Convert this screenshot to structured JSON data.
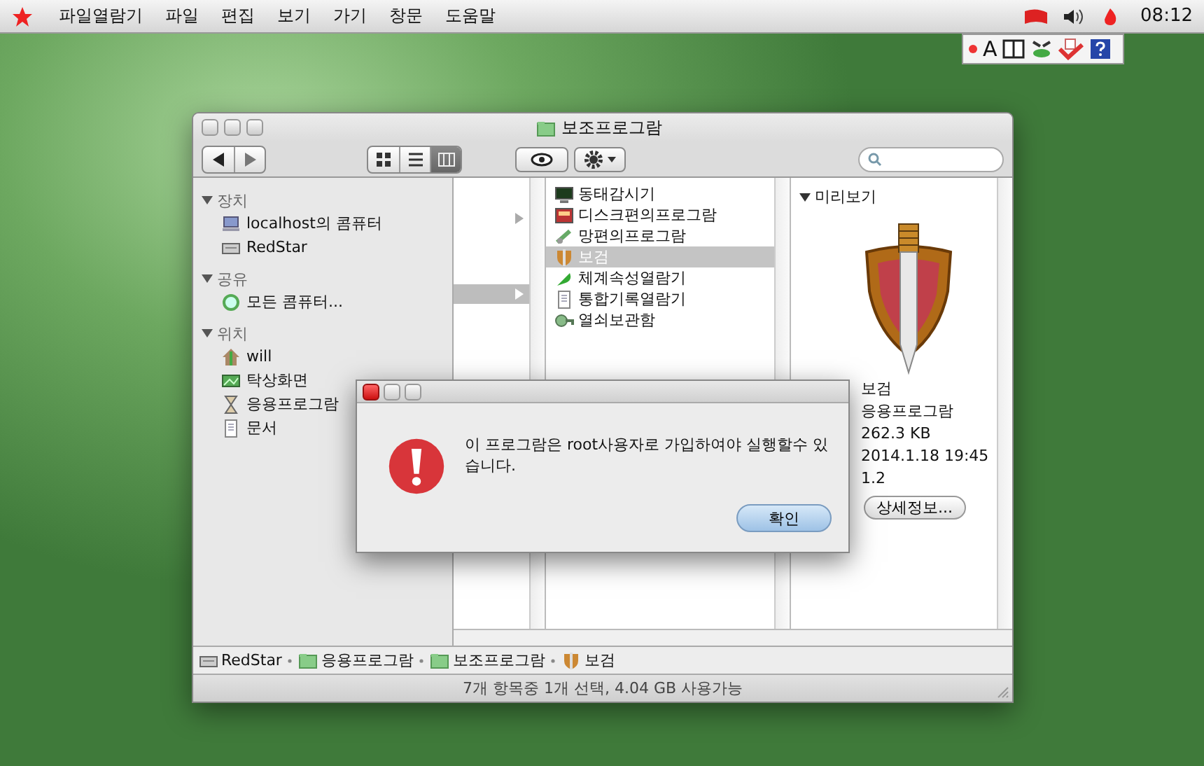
{
  "menubar": {
    "items": [
      {
        "label": "파일열람기",
        "selected": false
      },
      {
        "label": "파일",
        "selected": false
      },
      {
        "label": "편집",
        "selected": false
      },
      {
        "label": "보기",
        "selected": false
      },
      {
        "label": "가기",
        "selected": false
      },
      {
        "label": "창문",
        "selected": false
      },
      {
        "label": "도움말",
        "selected": false
      }
    ],
    "clock": "08:12"
  },
  "input_palette": {
    "letter": "A"
  },
  "finder": {
    "title": "보조프로그람",
    "view_modes": [
      {
        "selected": false
      },
      {
        "selected": false
      },
      {
        "selected": true
      }
    ],
    "sidebar": [
      {
        "title": "장치",
        "expanded": true,
        "items": [
          {
            "label": "localhost의 콤퓨터"
          },
          {
            "label": "RedStar"
          }
        ]
      },
      {
        "title": "공유",
        "expanded": true,
        "items": [
          {
            "label": "모든 콤퓨터..."
          }
        ]
      },
      {
        "title": "위치",
        "expanded": true,
        "items": [
          {
            "label": "will"
          },
          {
            "label": "탁상화면"
          },
          {
            "label": "응용프로그람"
          },
          {
            "label": "문서"
          }
        ]
      }
    ],
    "column_1": [
      {
        "selected": false
      },
      {
        "selected": true
      }
    ],
    "column_2": [
      {
        "label": "동태감시기",
        "selected": false
      },
      {
        "label": "디스크편의프로그람",
        "selected": false
      },
      {
        "label": "망편의프로그람",
        "selected": false
      },
      {
        "label": "보검",
        "selected": true
      },
      {
        "label": "체계속성열람기",
        "selected": false
      },
      {
        "label": "통합기록열람기",
        "selected": false
      },
      {
        "label": "열쇠보관함",
        "selected": false
      }
    ],
    "preview": {
      "heading": "미리보기",
      "expanded": true,
      "name": "보검",
      "kind": "응용프로그람",
      "size": "262.3 KB",
      "modified": "2014.1.18 19:45",
      "version": "1.2",
      "button": "상세정보..."
    },
    "path": [
      "RedStar",
      "응용프로그람",
      "보조프로그람",
      "보검"
    ],
    "status": "7개 항목중 1개 선택, 4.04 GB 사용가능"
  },
  "dialog": {
    "message": "이 프로그람은 root사용자로 가입하여야 실행할수 있습니다.",
    "button": "확인"
  }
}
